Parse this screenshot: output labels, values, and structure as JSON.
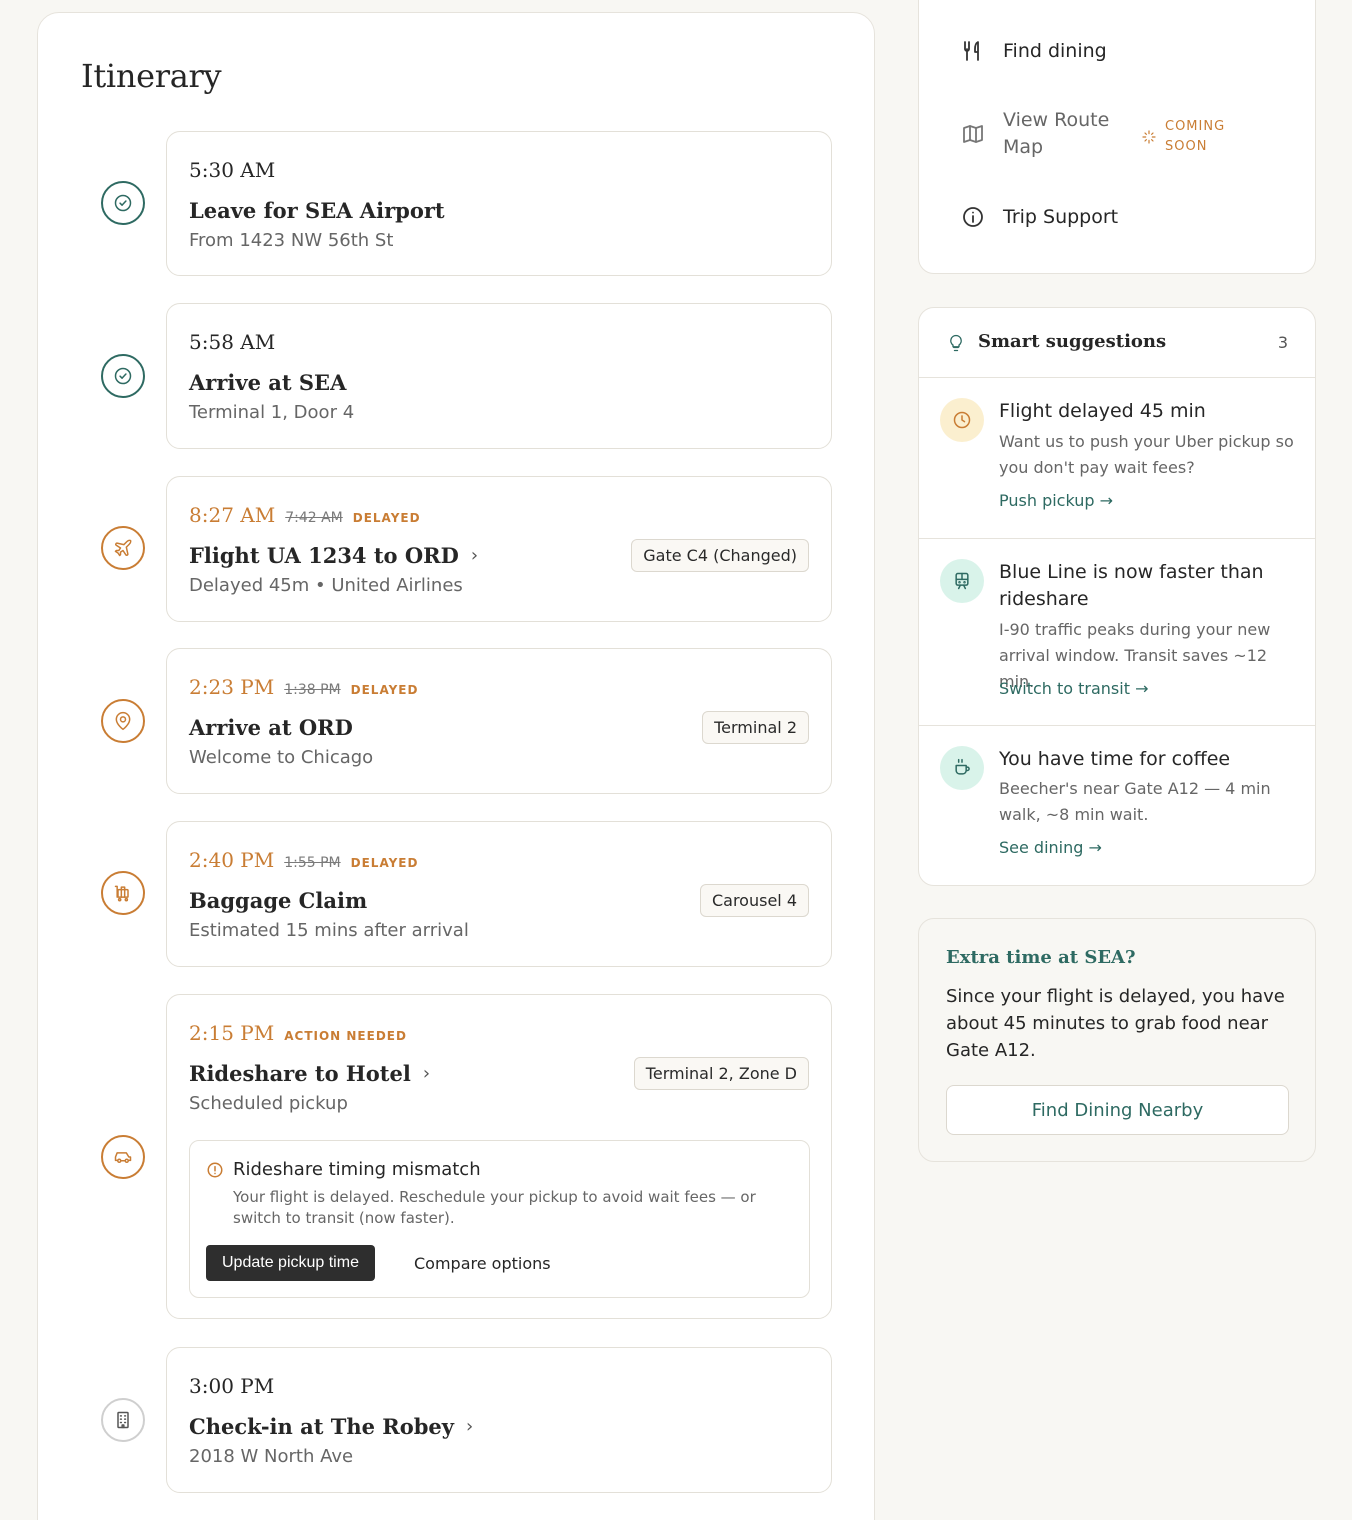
{
  "colors": {
    "teal": "#2e6a62",
    "orange": "#c97d34",
    "background": "#f8f7f3"
  },
  "itinerary": {
    "title": "Itinerary",
    "items": [
      {
        "icon": "check-circle-icon",
        "time": "5:30 AM",
        "title": "Leave for SEA Airport",
        "subtitle": "From 1423 NW 56th St"
      },
      {
        "icon": "check-circle-icon",
        "time": "5:58 AM",
        "title": "Arrive at SEA",
        "subtitle": "Terminal 1, Door 4"
      },
      {
        "icon": "plane-icon",
        "time": "8:27 AM",
        "old_time": "7:42 AM",
        "tag": "DELAYED",
        "title": "Flight UA 1234 to ORD",
        "subtitle": "Delayed 45m • United Airlines",
        "badge": "Gate C4 (Changed)"
      },
      {
        "icon": "map-pin-icon",
        "time": "2:23 PM",
        "old_time": "1:38 PM",
        "tag": "DELAYED",
        "title": "Arrive at ORD",
        "subtitle": "Welcome to Chicago",
        "badge": "Terminal 2"
      },
      {
        "icon": "luggage-cart-icon",
        "time": "2:40 PM",
        "old_time": "1:55 PM",
        "tag": "DELAYED",
        "title": "Baggage Claim",
        "subtitle": "Estimated 15 mins after arrival",
        "badge": "Carousel 4"
      },
      {
        "icon": "car-icon",
        "time": "2:15 PM",
        "tag": "ACTION NEEDED",
        "title": "Rideshare to Hotel",
        "subtitle": "Scheduled pickup",
        "badge": "Terminal 2, Zone D",
        "alert": {
          "title": "Rideshare timing mismatch",
          "text": "Your flight is delayed. Reschedule your pickup to avoid wait fees — or switch to transit (now faster).",
          "primary_label": "Update pickup time",
          "secondary_label": "Compare options"
        }
      },
      {
        "icon": "building-icon",
        "time": "3:00 PM",
        "title": "Check-in at The Robey",
        "subtitle": "2018 W North Ave"
      }
    ]
  },
  "quick_actions": {
    "find_dining": "Find dining",
    "view_route_map": "View Route Map",
    "coming_soon": "COMING SOON",
    "trip_support": "Trip Support"
  },
  "suggestions": {
    "title": "Smart suggestions",
    "count": "3",
    "items": [
      {
        "icon": "clock-icon",
        "title": "Flight delayed 45 min",
        "text": "Want us to push your Uber pickup so you don't pay wait fees?",
        "link": "Push pickup →"
      },
      {
        "icon": "train-icon",
        "title": "Blue Line is now faster than rideshare",
        "text": "I-90 traffic peaks during your new arrival window. Transit saves ~12 min.",
        "link": "Switch to transit →"
      },
      {
        "icon": "coffee-icon",
        "title": "You have time for coffee",
        "text": "Beecher's near Gate A12 — 4 min walk, ~8 min wait.",
        "link": "See dining →"
      }
    ]
  },
  "extra_time": {
    "title": "Extra time at SEA?",
    "text": "Since your flight is delayed, you have about 45 minutes to grab food near Gate A12.",
    "button": "Find Dining Nearby"
  }
}
